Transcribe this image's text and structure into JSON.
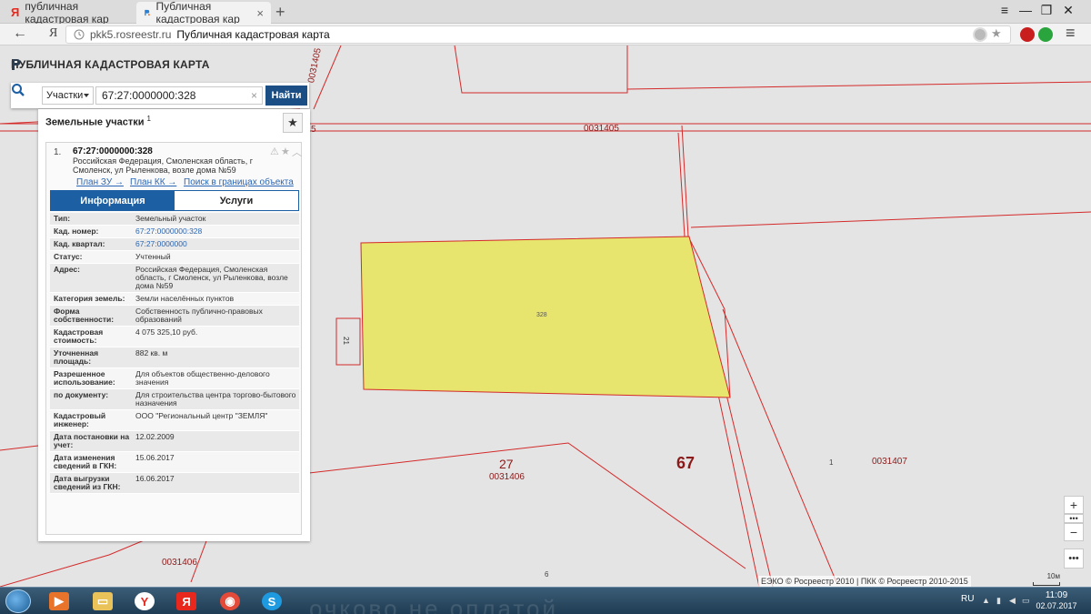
{
  "browser": {
    "tabs": [
      {
        "label": "публичная кадастровая кар",
        "active": false
      },
      {
        "label": "Публичная кадастровая кар",
        "active": true
      }
    ],
    "new_tab": "+",
    "window_controls": {
      "menu": "≡",
      "minimize": "—",
      "restore": "❐",
      "close": "✕"
    },
    "nav": {
      "back": "←",
      "yandex": "Я"
    },
    "url_host": "pkk5.rosreestr.ru",
    "url_title": "Публичная кадастровая карта"
  },
  "app": {
    "title": "ПУБЛИЧНАЯ КАДАСТРОВАЯ КАРТА",
    "search": {
      "type_select": "Участки",
      "query": "67:27:0000000:328",
      "clear": "×",
      "find_label": "Найти"
    },
    "results": {
      "header": "Земельные участки",
      "count": "1",
      "item": {
        "index": "1.",
        "number": "67:27:0000000:328",
        "address": "Российская Федерация, Смоленская область, г Смоленск, ул Рыленкова, возле дома №59",
        "links": [
          "План ЗУ →",
          "План КК →",
          "Поиск в границах объекта →"
        ],
        "tabs": [
          "Информация",
          "Услуги"
        ],
        "properties": [
          {
            "key": "Тип:",
            "value": "Земельный участок"
          },
          {
            "key": "Кад. номер:",
            "value": "67:27:0000000:328",
            "link": true
          },
          {
            "key": "Кад. квартал:",
            "value": "67:27:0000000",
            "link": true
          },
          {
            "key": "Статус:",
            "value": "Учтенный"
          },
          {
            "key": "Адрес:",
            "value": "Российская Федерация, Смоленская область, г Смоленск, ул Рыленкова, возле дома №59"
          },
          {
            "key": "Категория земель:",
            "value": "Земли населённых пунктов"
          },
          {
            "key": "Форма собственности:",
            "value": "Собственность публично-правовых образований"
          },
          {
            "key": "Кадастровая стоимость:",
            "value": "4 075 325,10 руб."
          },
          {
            "key": "Уточненная площадь:",
            "value": "882 кв. м"
          },
          {
            "key": "Разрешенное использование:",
            "value": "Для объектов общественно-делового значения"
          },
          {
            "key": "по документу:",
            "value": "Для строительства центра торгово-бытового назначения"
          },
          {
            "key": "Кадастровый инженер:",
            "value": "ООО \"Региональный центр \"ЗЕМЛЯ\""
          },
          {
            "key": "Дата постановки на учет:",
            "value": "12.02.2009"
          },
          {
            "key": "Дата изменения сведений в ГКН:",
            "value": "15.06.2017"
          },
          {
            "key": "Дата выгрузки сведений из ГКН:",
            "value": "16.06.2017"
          }
        ]
      }
    }
  },
  "map": {
    "labels": {
      "q_top_vertical": "0031405",
      "q_top_5": "5",
      "q_top": "0031405",
      "parcel": "328",
      "small_parcel": "21",
      "n27": "27",
      "q_bottom": "0031406",
      "n67": "67",
      "n1": "1",
      "q_right": "0031407",
      "q_bottom_left": "0031406",
      "n6": "6"
    },
    "controls": {
      "zoom_in": "+",
      "zoom_dots": "•••",
      "zoom_out": "−",
      "more": "•••"
    },
    "copyright": "ЕЭКО © Росреестр 2010 | ПКК © Росреестр 2010-2015",
    "scale": "10м",
    "colors": {
      "boundary": "#d42a2a",
      "parcel_fill": "#e8e56e",
      "label": "#8b1a1a"
    }
  },
  "taskbar": {
    "ghost_text": "очково не оплатой",
    "lang": "RU",
    "time": "11:09",
    "date": "02.07.2017"
  }
}
